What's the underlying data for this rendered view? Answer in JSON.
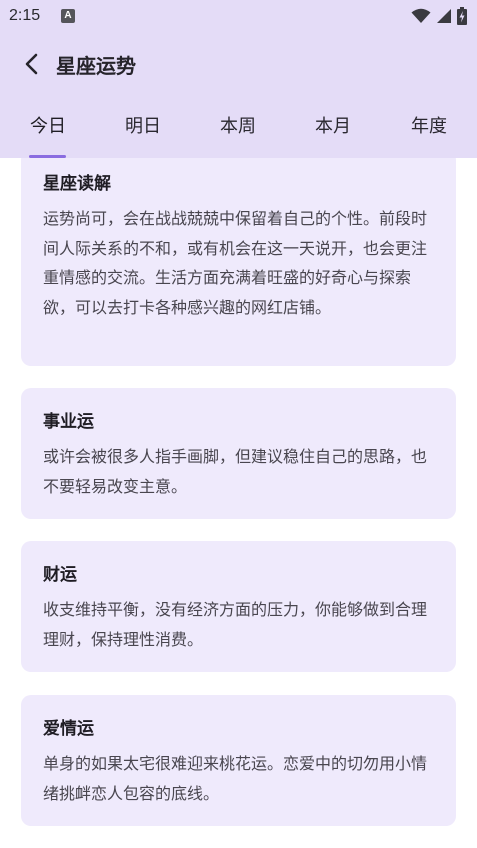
{
  "status": {
    "time": "2:15",
    "notif_letter": "A"
  },
  "app_bar": {
    "title": "星座运势"
  },
  "tabs": [
    {
      "label": "今日",
      "active": true
    },
    {
      "label": "明日",
      "active": false
    },
    {
      "label": "本周",
      "active": false
    },
    {
      "label": "本月",
      "active": false
    },
    {
      "label": "年度",
      "active": false
    }
  ],
  "sections": [
    {
      "title": "星座读解",
      "body": "运势尚可，会在战战兢兢中保留着自己的个性。前段时间人际关系的不和，或有机会在这一天说开，也会更注重情感的交流。生活方面充满着旺盛的好奇心与探索欲，可以去打卡各种感兴趣的网红店铺。"
    },
    {
      "title": "事业运",
      "body": "或许会被很多人指手画脚，但建议稳住自己的思路，也不要轻易改变主意。"
    },
    {
      "title": "财运",
      "body": "收支维持平衡，没有经济方面的压力，你能够做到合理理财，保持理性消费。"
    },
    {
      "title": "爱情运",
      "body": "单身的如果太宅很难迎来桃花运。恋爱中的切勿用小情绪挑衅恋人包容的底线。"
    }
  ],
  "colors": {
    "header_bg": "#e4dcf7",
    "card_bg": "#efeafc",
    "accent": "#8a6ce0"
  },
  "icons": {
    "back": "arrow-left-icon",
    "wifi": "wifi-icon",
    "signal": "signal-icon",
    "battery": "battery-charging-icon"
  }
}
